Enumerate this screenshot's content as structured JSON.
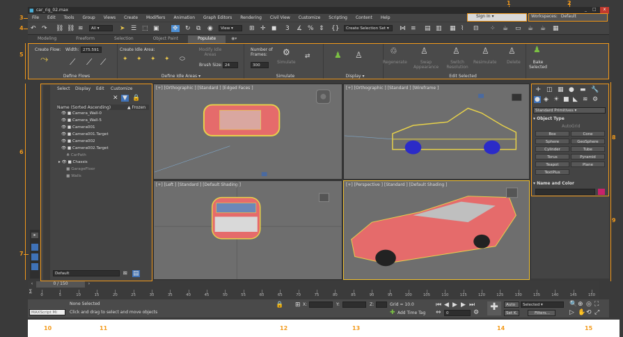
{
  "window": {
    "title": "car_rig_02.max",
    "sign_in": "Sign In",
    "workspaces_label": "Workspaces:",
    "workspace_value": "Default"
  },
  "menu": [
    "File",
    "Edit",
    "Tools",
    "Group",
    "Views",
    "Create",
    "Modifiers",
    "Animation",
    "Graph Editors",
    "Rendering",
    "Civil View",
    "Customize",
    "Scripting",
    "Content",
    "Help"
  ],
  "toolbar": {
    "filter": "All",
    "view": "View",
    "selection_set": "Create Selection Set"
  },
  "ribbon_tabs": [
    "Modeling",
    "Freeform",
    "Selection",
    "Object Paint",
    "Populate"
  ],
  "ribbon": {
    "create_flow_label": "Create Flow:",
    "width_label": "Width:",
    "width_value": "275.591",
    "define_flows": "Define Flows",
    "create_idle_label": "Create Idle Area:",
    "modify_idle": "Modify Idle Areas",
    "brush_size_label": "Brush Size:",
    "brush_size_value": "24",
    "define_idle": "Define Idle Areas",
    "number_of_frames": "Number of Frames:",
    "frames_value": "300",
    "simulate": "Simulate",
    "simulate_group": "Simulate",
    "display_group": "Display",
    "regenerate": "Regenerate",
    "swap": "Swap Appearance",
    "switch": "Switch Resolution",
    "resimulate": "Resimulate",
    "delete": "Delete",
    "edit_selected": "Edit Selected",
    "bake": "Bake Selected"
  },
  "explorer": {
    "tabs": [
      "Select",
      "Display",
      "Edit",
      "Customize"
    ],
    "col_name": "Name (Sorted Ascending)",
    "col_frozen": "▲ Frozen",
    "items": [
      "Camera_Wall-0",
      "Camera_Wall-5",
      "Camera001",
      "Camera001.Target",
      "Camera002",
      "Camera002.Target",
      "CarPath",
      "Chassis",
      "GarageFloor",
      "Walls"
    ],
    "layer": "Default"
  },
  "viewports": {
    "top": "[+] [Orthographic ] [Standard ] [Edged Faces ]",
    "front": "[+] [Orthographic ] [Standard ] [Wireframe ]",
    "left": "[+] [Left ] [Standard ] [Default Shading ]",
    "persp": "[+] [Perspective ] [Standard ] [Default Shading ]"
  },
  "command_panel": {
    "category": "Standard Primitives",
    "object_type": "Object Type",
    "autogrid": "AutoGrid",
    "buttons": [
      "Box",
      "Cone",
      "Sphere",
      "GeoSphere",
      "Cylinder",
      "Tube",
      "Torus",
      "Pyramid",
      "Teapot",
      "Plane",
      "TextPlus"
    ],
    "name_color": "Name and Color",
    "swatch_color": "#c8226b"
  },
  "timeline": {
    "frame": "0 / 150",
    "ticks": [
      "0",
      "5",
      "10",
      "15",
      "20",
      "25",
      "30",
      "35",
      "40",
      "45",
      "50",
      "55",
      "60",
      "65",
      "70",
      "75",
      "80",
      "85",
      "90",
      "95",
      "100",
      "105",
      "110",
      "115",
      "120",
      "125",
      "130",
      "135",
      "140",
      "145",
      "150"
    ]
  },
  "status": {
    "script": "MAXScript Mi",
    "none_selected": "None Selected",
    "hint": "Click and drag to select and move objects",
    "x": "X:",
    "y": "Y:",
    "z": "Z:",
    "grid": "Grid = 10.0",
    "add_time_tag": "Add Time Tag",
    "frame_spinner": "0",
    "auto": "Auto",
    "selected": "Selected",
    "set_k": "Set K.",
    "filters": "Filters..."
  },
  "callouts": [
    "1",
    "2",
    "3",
    "4",
    "5",
    "6",
    "7",
    "8",
    "9",
    "10",
    "11",
    "12",
    "13",
    "14",
    "15"
  ],
  "colors": {
    "accent": "#f39a1b",
    "active": "#f2c232",
    "car": "#e56b6b",
    "wire": "#e8d24a"
  }
}
